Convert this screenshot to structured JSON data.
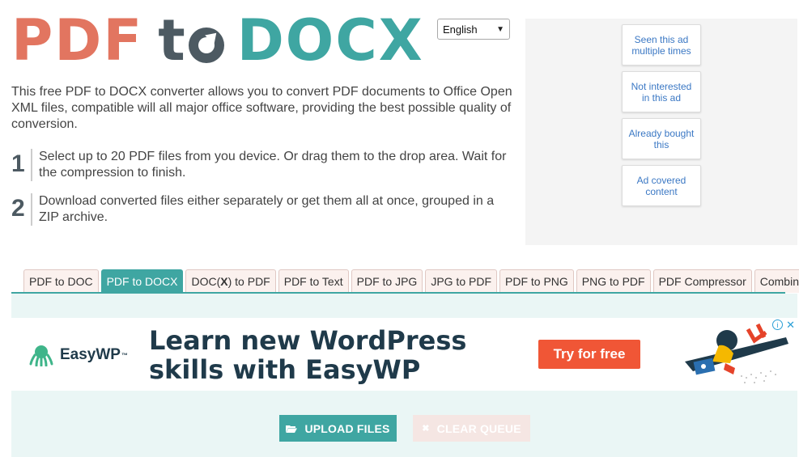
{
  "logo": {
    "pdf": "PDF",
    "to": "t",
    "docx": "DOCX"
  },
  "language": {
    "selected": "English"
  },
  "intro": "This free PDF to DOCX converter allows you to convert PDF documents to Office Open XML files, compatible will all major office software, providing the best possible quality of conversion.",
  "steps": [
    {
      "num": "1",
      "text": "Select up to 20 PDF files from you device. Or drag them to the drop area. Wait for the compression to finish."
    },
    {
      "num": "2",
      "text": "Download converted files either separately or get them all at once, grouped in a ZIP archive."
    }
  ],
  "ad_feedback": [
    {
      "label": "Seen this ad multiple times"
    },
    {
      "label": "Not interested in this ad"
    },
    {
      "label": "Already bought this"
    },
    {
      "label": "Ad covered content"
    }
  ],
  "tabs": [
    {
      "label": "PDF to DOC",
      "active": false
    },
    {
      "label": "PDF to DOCX",
      "active": true
    },
    {
      "label_pre": "DOC(",
      "label_bold": "X",
      "label_post": ") to PDF",
      "active": false
    },
    {
      "label": "PDF to Text",
      "active": false
    },
    {
      "label": "PDF to JPG",
      "active": false
    },
    {
      "label": "JPG to PDF",
      "active": false
    },
    {
      "label": "PDF to PNG",
      "active": false
    },
    {
      "label": "PNG to PDF",
      "active": false
    },
    {
      "label": "PDF Compressor",
      "active": false
    },
    {
      "label": "Combine PDF",
      "active": false
    }
  ],
  "banner": {
    "brand": "EasyWP",
    "tm": "™",
    "headline_line1": "Learn new WordPress",
    "headline_line2": "skills with EasyWP",
    "cta": "Try for free",
    "info": "i",
    "close": "✕"
  },
  "buttons": {
    "upload": "UPLOAD FILES",
    "clear": "CLEAR QUEUE"
  },
  "colors": {
    "teal": "#3fa6a2",
    "salmon": "#e27560",
    "slate": "#4d5a62",
    "cta": "#f05636"
  }
}
